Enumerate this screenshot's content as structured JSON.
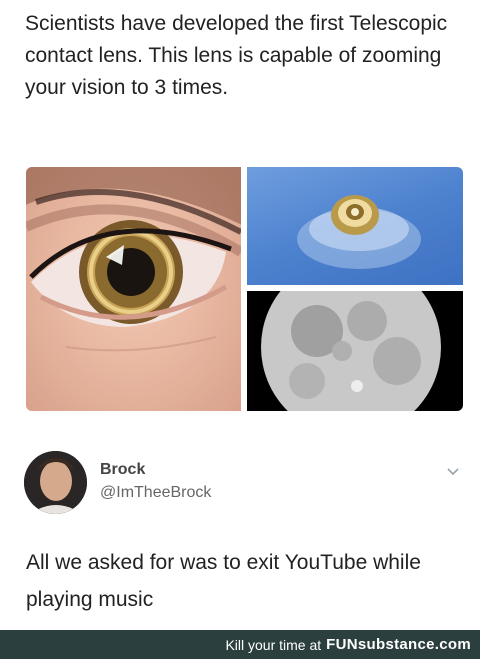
{
  "post": {
    "headline": "Scientists have developed the first Telescopic contact lens. This lens is capable of zooming your vision to 3 times."
  },
  "tweet": {
    "author_name": "Brock",
    "author_handle": "@ImTheeBrock",
    "text": "All we asked for was to exit YouTube while playing music"
  },
  "footer": {
    "tagline": "Kill your time at",
    "brand": "FUNsubstance.com"
  },
  "images": [
    "eye-with-lens-photo",
    "contact-lens-photo",
    "moon-photo"
  ],
  "icons": [
    "chevron-down-icon"
  ],
  "colors": {
    "footer_bg": "#2b3f3e",
    "lens_bg": "#4d82cf",
    "text": "#222222"
  }
}
